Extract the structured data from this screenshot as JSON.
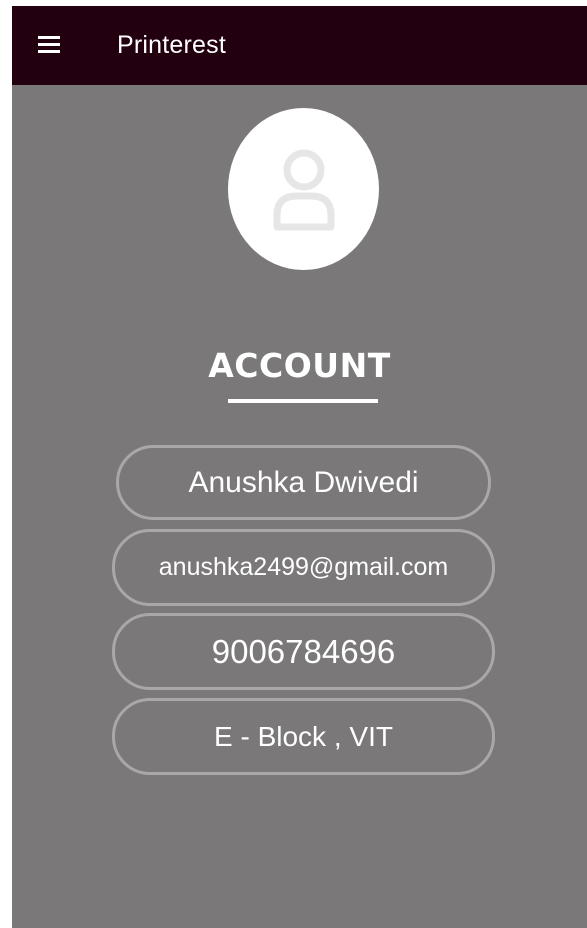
{
  "app_bar": {
    "title": "Printerest",
    "menu_icon": "hamburger-menu-icon"
  },
  "profile": {
    "avatar_icon": "user-placeholder-icon",
    "section_title": "ACCOUNT",
    "name": "Anushka Dwivedi",
    "email": "anushka2499@gmail.com",
    "phone": "9006784696",
    "address": "E - Block , VIT"
  },
  "colors": {
    "app_bar_bg": "#220010",
    "screen_bg": "#7a7878",
    "field_border": "#a9a7a7",
    "text": "#ffffff",
    "avatar_bg": "#ffffff",
    "avatar_icon": "#e6e6e6"
  }
}
